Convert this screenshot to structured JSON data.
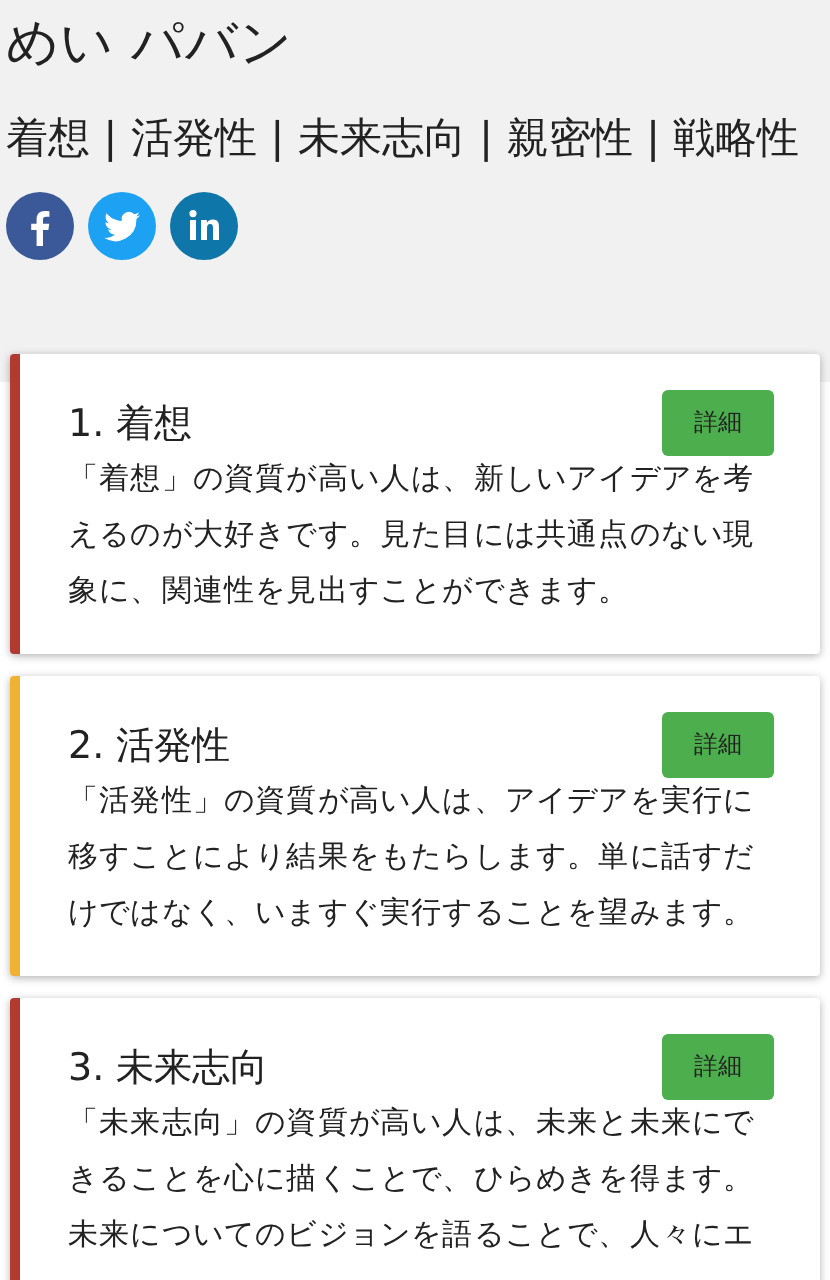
{
  "profile": {
    "name": "めい パバン",
    "strengths": "着想 | 活発性 | 未来志向 | 親密性 | 戦略性",
    "social": [
      {
        "kind": "facebook"
      },
      {
        "kind": "twitter"
      },
      {
        "kind": "linkedin"
      }
    ]
  },
  "cards": [
    {
      "title": "1. 着想",
      "color": "#b23b31",
      "button": "詳細",
      "text": "「着想」の資質が高い人は、新しいアイデアを考えるのが大好きです。見た目には共通点のない現象に、関連性を見出すことができます。"
    },
    {
      "title": "2. 活発性",
      "color": "#f0b232",
      "button": "詳細",
      "text": "「活発性」の資質が高い人は、アイデアを実行に移すことにより結果をもたらします。単に話すだけではなく、いますぐ実行することを望みます。"
    },
    {
      "title": "3. 未来志向",
      "color": "#b23b31",
      "button": "詳細",
      "text": "「未来志向」の資質が高い人は、未来と未来にできることを心に描くことで、ひらめきを得ます。未来についてのビジョンを語ることで、人々にエ"
    }
  ]
}
